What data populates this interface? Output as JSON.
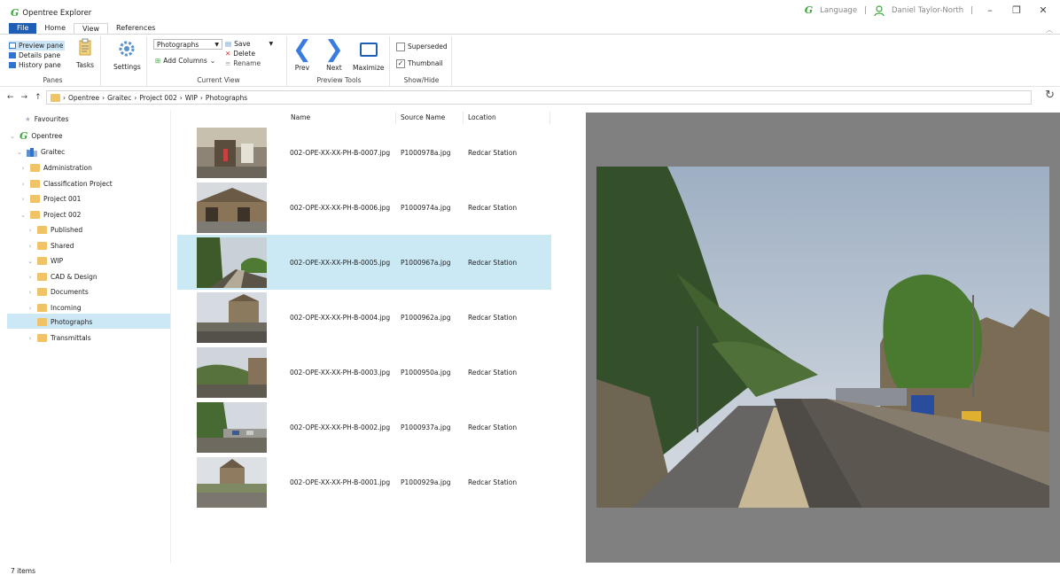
{
  "app": {
    "title": "Opentree Explorer",
    "logo": "G"
  },
  "header": {
    "language_label": "Language",
    "user_name": "Daniel Taylor-North",
    "separator": "|"
  },
  "window_controls": {
    "minimize": "–",
    "restore": "❐",
    "close": "✕"
  },
  "menu": {
    "tabs": [
      "File",
      "Home",
      "View",
      "References"
    ],
    "active": "View"
  },
  "ribbon": {
    "panes": {
      "label": "Panes",
      "items": [
        "Preview pane",
        "Details pane",
        "History pane"
      ],
      "tasks": "Tasks",
      "settings": "Settings"
    },
    "current_view": {
      "label": "Current View",
      "view_select": "Photographs",
      "add_columns": "Add Columns",
      "save": "Save",
      "delete": "Delete",
      "rename": "Rename"
    },
    "preview_tools": {
      "label": "Preview Tools",
      "prev": "Prev",
      "next": "Next",
      "maximize": "Maximize"
    },
    "show_hide": {
      "label": "Show/Hide",
      "superseded": "Superseded",
      "superseded_checked": false,
      "thumbnail": "Thumbnail",
      "thumbnail_checked": true
    }
  },
  "address": {
    "breadcrumb": [
      "Opentree",
      "Graitec",
      "Project 002",
      "WIP",
      "Photographs"
    ]
  },
  "tree": {
    "favourites": "Favourites",
    "root": "Opentree",
    "company": "Graitec",
    "items": [
      {
        "label": "Administration"
      },
      {
        "label": "Classification Project"
      },
      {
        "label": "Project 001"
      },
      {
        "label": "Project 002"
      },
      {
        "label": "Published"
      },
      {
        "label": "Shared"
      },
      {
        "label": "WIP"
      },
      {
        "label": "CAD & Design"
      },
      {
        "label": "Documents"
      },
      {
        "label": "Incoming"
      },
      {
        "label": "Photographs"
      },
      {
        "label": "Transmittals"
      }
    ],
    "selected": "Photographs"
  },
  "columns": [
    "Name",
    "Source Name",
    "Location"
  ],
  "rows": [
    {
      "name": "002-OPE-XX-XX-PH-B-0007.jpg",
      "source": "P1000978a.jpg",
      "location": "Redcar Station"
    },
    {
      "name": "002-OPE-XX-XX-PH-B-0006.jpg",
      "source": "P1000974a.jpg",
      "location": "Redcar Station"
    },
    {
      "name": "002-OPE-XX-XX-PH-B-0005.jpg",
      "source": "P1000967a.jpg",
      "location": "Redcar Station"
    },
    {
      "name": "002-OPE-XX-XX-PH-B-0004.jpg",
      "source": "P1000962a.jpg",
      "location": "Redcar Station"
    },
    {
      "name": "002-OPE-XX-XX-PH-B-0003.jpg",
      "source": "P1000950a.jpg",
      "location": "Redcar Station"
    },
    {
      "name": "002-OPE-XX-XX-PH-B-0002.jpg",
      "source": "P1000937a.jpg",
      "location": "Redcar Station"
    },
    {
      "name": "002-OPE-XX-XX-PH-B-0001.jpg",
      "source": "P1000929a.jpg",
      "location": "Redcar Station"
    }
  ],
  "selected_row": "002-OPE-XX-XX-PH-B-0005.jpg",
  "status": {
    "count": "7 items"
  },
  "icons": [
    "back-arrow-icon",
    "forward-arrow-icon",
    "up-arrow-icon",
    "folder-icon",
    "refresh-icon",
    "star-icon",
    "chevron-right-icon",
    "chevron-down-icon",
    "user-icon",
    "gear-icon",
    "clipboard-icon",
    "save-icon",
    "delete-icon",
    "rename-icon",
    "prev-icon",
    "next-icon",
    "maximize-icon"
  ],
  "colors": {
    "accent": "#1e5fb5",
    "selection": "#cbe8f5",
    "folder": "#f0c466",
    "brand_green": "#3aa53a"
  }
}
